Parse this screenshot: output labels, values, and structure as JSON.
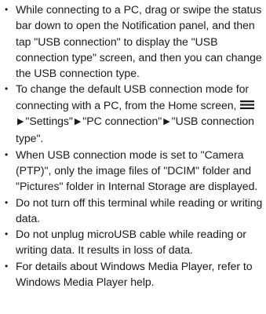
{
  "notes": [
    {
      "text": "While connecting to a PC, drag or swipe the status bar down to open the Notification panel, and then tap \"USB connection\" to display the \"USB connection type\" screen, and then you can change the USB connection type."
    },
    {
      "text_before_icon": "To change the default USB connection mode for connecting with a PC, from the Home screen, ",
      "icon": "menu-icon",
      "step_1": "\"Settings\"",
      "step_2": "\"PC connection\"",
      "step_3": "\"USB connection type\".",
      "arrow_glyph": "▶"
    },
    {
      "text": "When USB connection mode is set to \"Camera (PTP)\", only the image files of \"DCIM\" folder and \"Pictures\" folder in Internal Storage are displayed."
    },
    {
      "text": "Do not turn off this terminal while reading or writing data."
    },
    {
      "text": "Do not unplug microUSB cable while reading or writing data. It results in loss of data."
    },
    {
      "text": "For details about Windows Media Player, refer to Windows Media Player help."
    }
  ],
  "bullet_glyph": "•"
}
